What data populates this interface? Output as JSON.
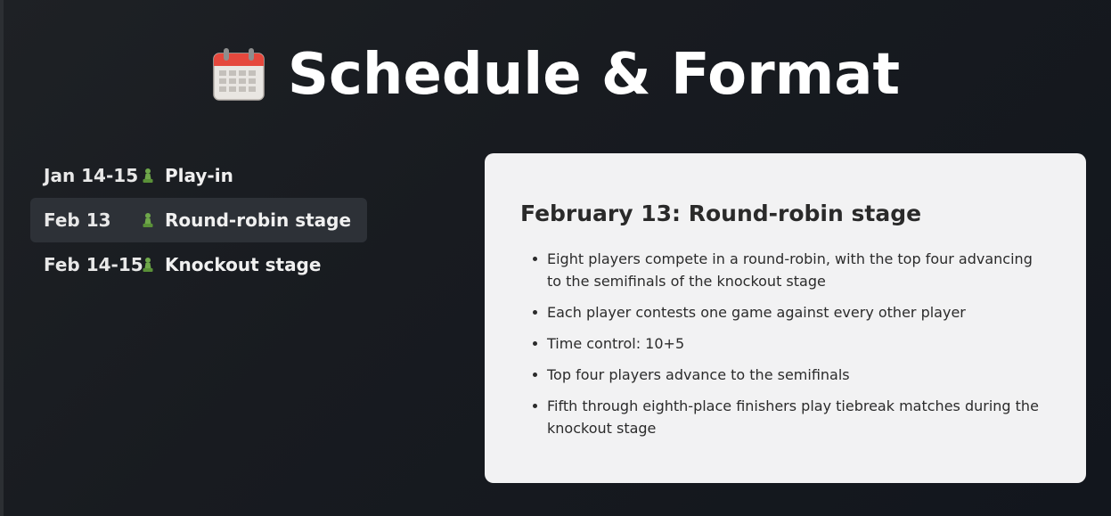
{
  "header": {
    "title": "Schedule & Format",
    "icon": "calendar-icon"
  },
  "schedule": {
    "items": [
      {
        "date": "Jan 14-15",
        "label": "Play-in",
        "icon": "pawn-icon",
        "active": false
      },
      {
        "date": "Feb 13",
        "label": "Round-robin stage",
        "icon": "pawn-icon",
        "active": true
      },
      {
        "date": "Feb 14-15",
        "label": "Knockout stage",
        "icon": "pawn-icon",
        "active": false
      }
    ]
  },
  "detail": {
    "title": "February 13: Round-robin stage",
    "bullets": [
      "Eight players compete in a round-robin, with the top four advancing to the semifinals of the knockout stage",
      "Each player contests one game against every other player",
      "Time control: 10+5",
      "Top four players advance to the semifinals",
      "Fifth through eighth-place finishers play tiebreak matches during the knockout stage"
    ]
  },
  "colors": {
    "background": "#181b20",
    "active_item": "#2d3137",
    "card_background": "#f2f2f3",
    "pawn_green": "#6fa84a"
  }
}
